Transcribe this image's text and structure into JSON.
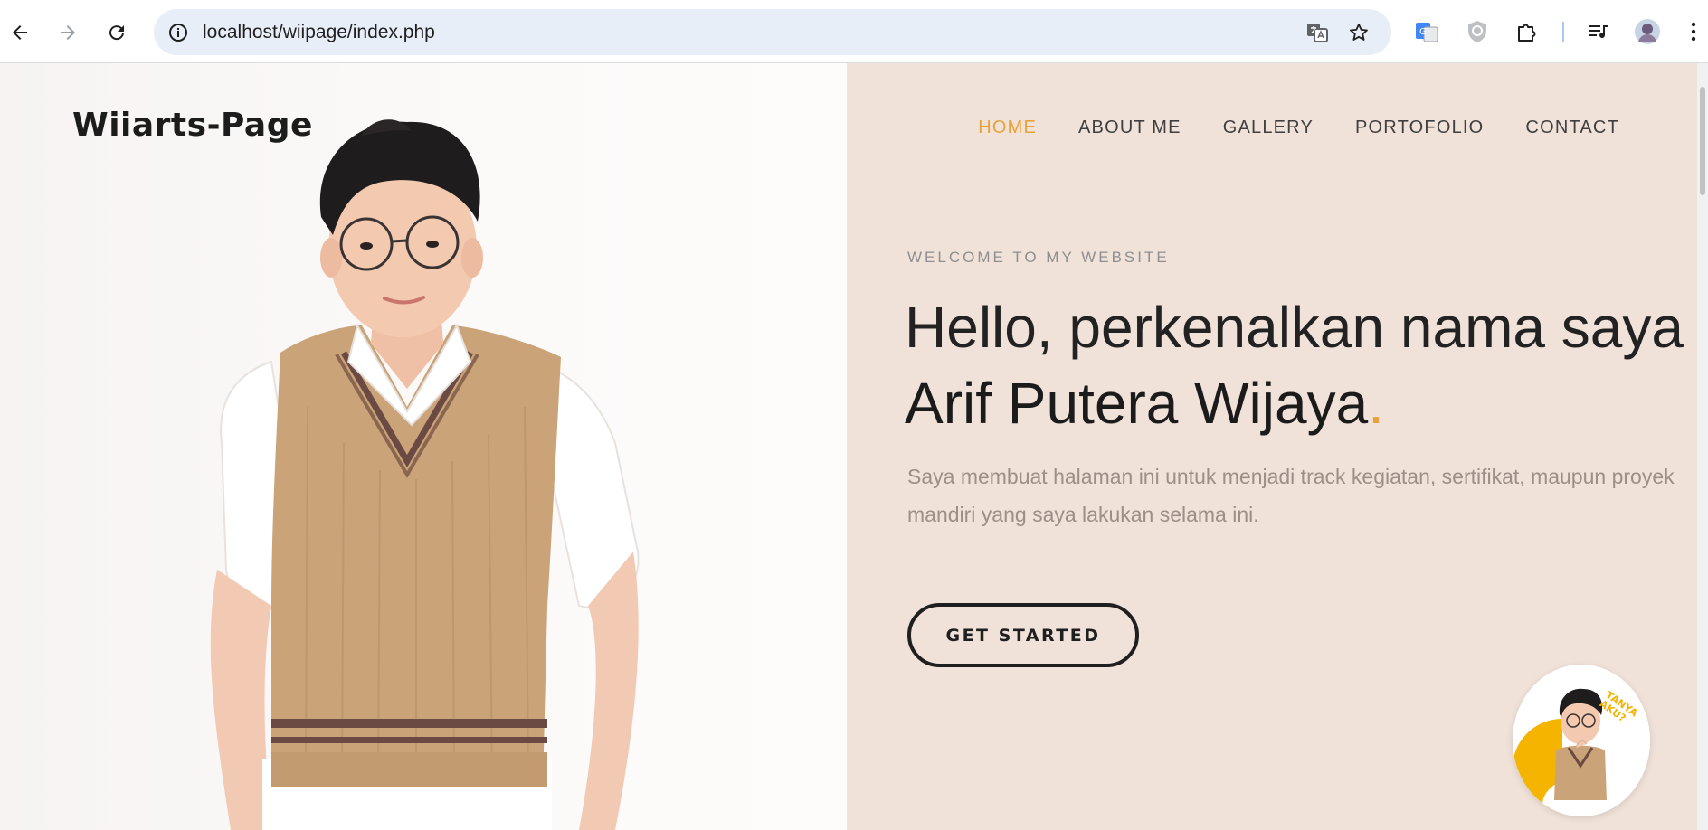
{
  "browser": {
    "url": "localhost/wiipage/index.php",
    "icons": {
      "back": "arrow-left-icon",
      "forward": "arrow-right-icon",
      "reload": "reload-icon",
      "site_info": "info-icon",
      "translate": "translate-icon",
      "bookmark": "star-icon",
      "ext_translate": "google-translate-icon",
      "ext_shield": "shield-icon",
      "extensions": "puzzle-icon",
      "media": "media-queue-icon",
      "profile": "avatar"
    }
  },
  "site": {
    "logo": "Wiiarts-Page",
    "nav": [
      {
        "label": "HOME"
      },
      {
        "label": "ABOUT ME"
      },
      {
        "label": "GALLERY"
      },
      {
        "label": "PORTOFOLIO"
      },
      {
        "label": "CONTACT"
      }
    ],
    "active_nav": "HOME",
    "eyebrow": "WELCOME TO MY WEBSITE",
    "headline_line1": "Hello, perkenalkan nama saya",
    "headline_name": "Arif Putera Wijaya",
    "headline_dot": ".",
    "description": "Saya membuat halaman ini untuk menjadi track kegiatan, sertifikat, maupun proyek mandiri yang saya lakukan selama ini.",
    "cta_label": "GET STARTED",
    "chat_badge_text": "TANYA AKU?"
  },
  "colors": {
    "accent": "#e6a339",
    "right_panel_bg": "#f0e2d8",
    "text_dark": "#1f1f1f"
  }
}
